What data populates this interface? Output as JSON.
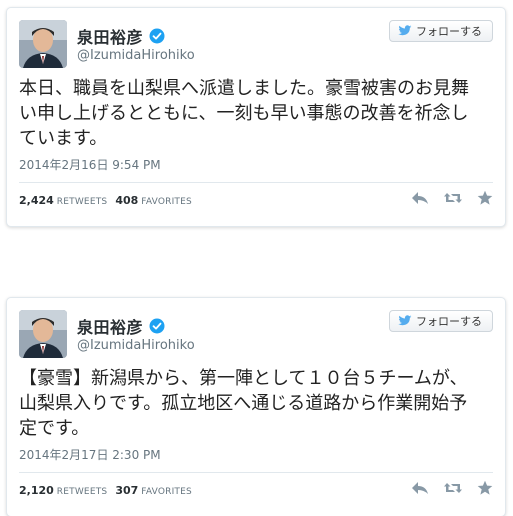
{
  "tweets": [
    {
      "display_name": "泉田裕彦",
      "screen_name": "@IzumidaHirohiko",
      "follow_label": "フォローする",
      "text": "本日、職員を山梨県へ派遣しました。豪雪被害のお見舞\nい申し上げるとともに、一刻も早い事態の改善を祈念し\nています。",
      "timestamp": "2014年2月16日 9:54 PM",
      "retweets": "2,424",
      "retweets_label": "RETWEETS",
      "favorites": "408",
      "favorites_label": "FAVORITES"
    },
    {
      "display_name": "泉田裕彦",
      "screen_name": "@IzumidaHirohiko",
      "follow_label": "フォローする",
      "text": "【豪雪】新潟県から、第一陣として１０台５チームが、\n山梨県入りです。孤立地区へ通じる道路から作業開始予\n定です。",
      "timestamp": "2014年2月17日 2:30 PM",
      "retweets": "2,120",
      "retweets_label": "RETWEETS",
      "favorites": "307",
      "favorites_label": "FAVORITES"
    }
  ],
  "colors": {
    "verified": "#1da1f2",
    "follow_bird": "#55acee",
    "action_icon": "#8899a6"
  },
  "icons": [
    "verified-badge-icon",
    "twitter-bird-icon",
    "reply-icon",
    "retweet-icon",
    "favorite-star-icon"
  ]
}
